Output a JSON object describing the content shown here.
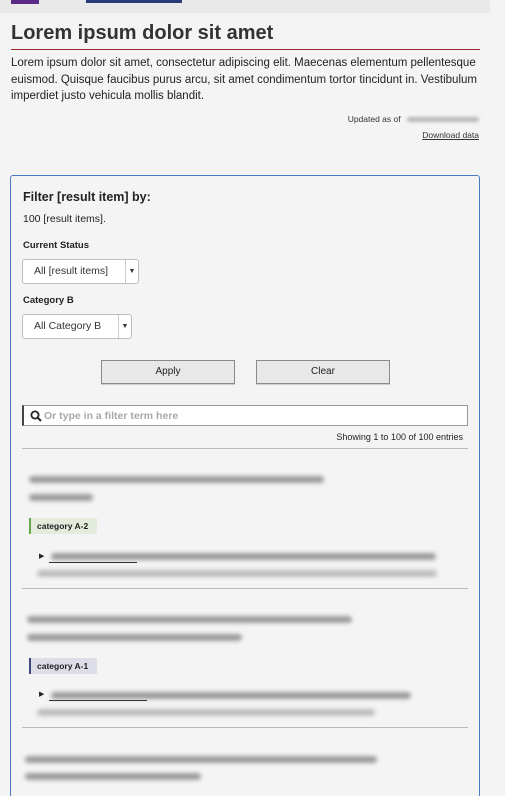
{
  "page": {
    "title": "Lorem ipsum dolor sit amet",
    "intro": "Lorem ipsum dolor sit amet, consectetur adipiscing elit. Maecenas elementum pellentesque euismod. Quisque faucibus purus arcu, sit amet condimentum tortor tincidunt in. Vestibulum imperdiet justo vehicula mollis blandit.",
    "updated_label": "Updated as of",
    "download_label": "Download data"
  },
  "filter": {
    "heading": "Filter [result item] by:",
    "count": "100 [result items].",
    "status_label": "Current Status",
    "status_value": "All [result items]",
    "category_label": "Category B",
    "category_value": "All Category B",
    "apply_label": "Apply",
    "clear_label": "Clear",
    "search_placeholder": "Or type in a filter term here",
    "showing": "Showing 1 to 100 of 100 entries"
  },
  "results": [
    {
      "tag": "category A-2",
      "tag_color": "#6aa84f"
    },
    {
      "tag": "category A-1",
      "tag_color": "#3d4a80"
    }
  ],
  "colors": {
    "accent_border": "#4a79c1",
    "title_rule": "#9a2a2a"
  },
  "icons": {
    "search": "search-icon",
    "dropdown": "caret-down-icon",
    "expand": "triangle-right-icon"
  }
}
